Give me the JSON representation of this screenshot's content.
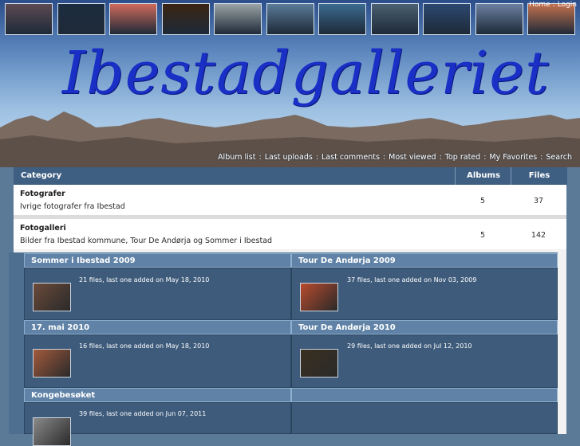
{
  "header": {
    "logo": "Ibestadgalleriet",
    "top_links": [
      "Home",
      "Login"
    ],
    "nav": [
      "Album list",
      "Last uploads",
      "Last comments",
      "Most viewed",
      "Top rated",
      "My Favorites",
      "Search"
    ],
    "thumb_colors": [
      "#5b4a52",
      "#1c2c40",
      "#d06a5c",
      "#3a2412",
      "#9aa3a6",
      "#5a7a98",
      "#3b6a8f",
      "#4a6071",
      "#2c4870",
      "#6a7fa0",
      "#c3714e"
    ]
  },
  "table": {
    "headers": {
      "category": "Category",
      "albums": "Albums",
      "files": "Files"
    },
    "rows": [
      {
        "title": "Fotografer",
        "desc": "Ivrige fotografer fra Ibestad",
        "albums": "5",
        "files": "37"
      },
      {
        "title": "Fotogalleri",
        "desc": "Bilder fra Ibestad kommune, Tour De Andørja og Sommer i Ibestad",
        "albums": "5",
        "files": "142"
      }
    ]
  },
  "albums": [
    {
      "title": "Sommer i Ibestad 2009",
      "info": "21 files, last one added on May 18, 2010"
    },
    {
      "title": "Tour De Andørja 2009",
      "info": "37 files, last one added on Nov 03, 2009"
    },
    {
      "title": "17. mai 2010",
      "info": "16 files, last one added on May 18, 2010"
    },
    {
      "title": "Tour De Andørja 2010",
      "info": "29 files, last one added on Jul 12, 2010"
    },
    {
      "title": "Kongebesøket",
      "info": "39 files, last one added on Jun 07, 2011"
    }
  ],
  "album_thumb_colors": [
    "#6b4a3a",
    "#b84a2c",
    "#a35a3c",
    "#3a3020",
    "#8a8a8a"
  ]
}
